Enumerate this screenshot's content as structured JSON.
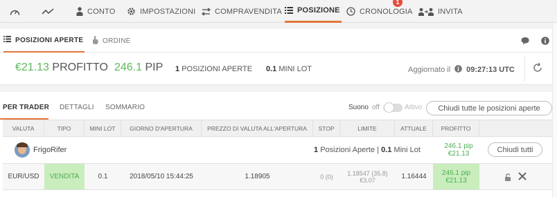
{
  "nav": {
    "items": [
      {
        "icon": "dashboard-gauge-icon",
        "label": ""
      },
      {
        "icon": "chart-line-icon",
        "label": ""
      },
      {
        "icon": "person-icon",
        "label": "CONTO"
      },
      {
        "icon": "gear-icon",
        "label": "IMPOSTAZIONI"
      },
      {
        "icon": "transfer-arrows-icon",
        "label": "COMPRAVENDITA"
      },
      {
        "icon": "list-icon",
        "label": "POSIZIONE",
        "active": true
      },
      {
        "icon": "clock-icon",
        "label": "CRONOLOGIA",
        "badge": "1"
      },
      {
        "icon": "invite-people-icon",
        "label": "INVITA"
      }
    ],
    "accent": "#e0753a"
  },
  "subtabs": {
    "open_positions": "POSIZIONI APERTE",
    "orders": "ORDINE"
  },
  "summary": {
    "profit_value": "€21.13",
    "profit_label": "PROFITTO",
    "pip_value": "246.1",
    "pip_label": "PIP",
    "open_count": "1",
    "open_label": "POSIZIONI APERTE",
    "mini_lot_value": "0.1",
    "mini_lot_label": "MINI LOT",
    "updated_label": "Aggiornato il",
    "updated_time": "09:27:13 UTC",
    "green": "#5cb85c"
  },
  "table": {
    "tabs": [
      "PER TRADER",
      "DETTAGLI",
      "SOMMARIO"
    ],
    "sound_label": "Suono",
    "sound_off": "off",
    "sound_on": "Attivo",
    "close_all_label": "Chiudi tutte le posizioni aperte",
    "columns": [
      "VALUTA",
      "TIPO",
      "MINI LOT",
      "GIORNO D'APERTURA",
      "PREZZO DI VALUTA ALL'APERTURA",
      "STOP",
      "LIMITE",
      "ATTUALE",
      "PROFITTO"
    ],
    "trader": {
      "name": "FrigoRifer",
      "open_count": "1",
      "open_label": "Posizioni Aperte",
      "separator": "|",
      "mini_lot": "0.1",
      "mini_lot_label": "Mini Lot",
      "profit_pip": "246.1 pip",
      "profit_eur": "€21.13",
      "close_label": "Chiudi tutti"
    },
    "row": {
      "currency": "EUR/USD",
      "type": "VENDITA",
      "mini_lot": "0.1",
      "open_date": "2018/05/10 15:44:25",
      "open_price": "1.18905",
      "stop": "0 (0)",
      "limit_main": "1.18547 (35.8)",
      "limit_eur": "€3.07",
      "current": "1.16444",
      "profit_pip": "246.1 pip",
      "profit_eur": "€21.13"
    }
  }
}
